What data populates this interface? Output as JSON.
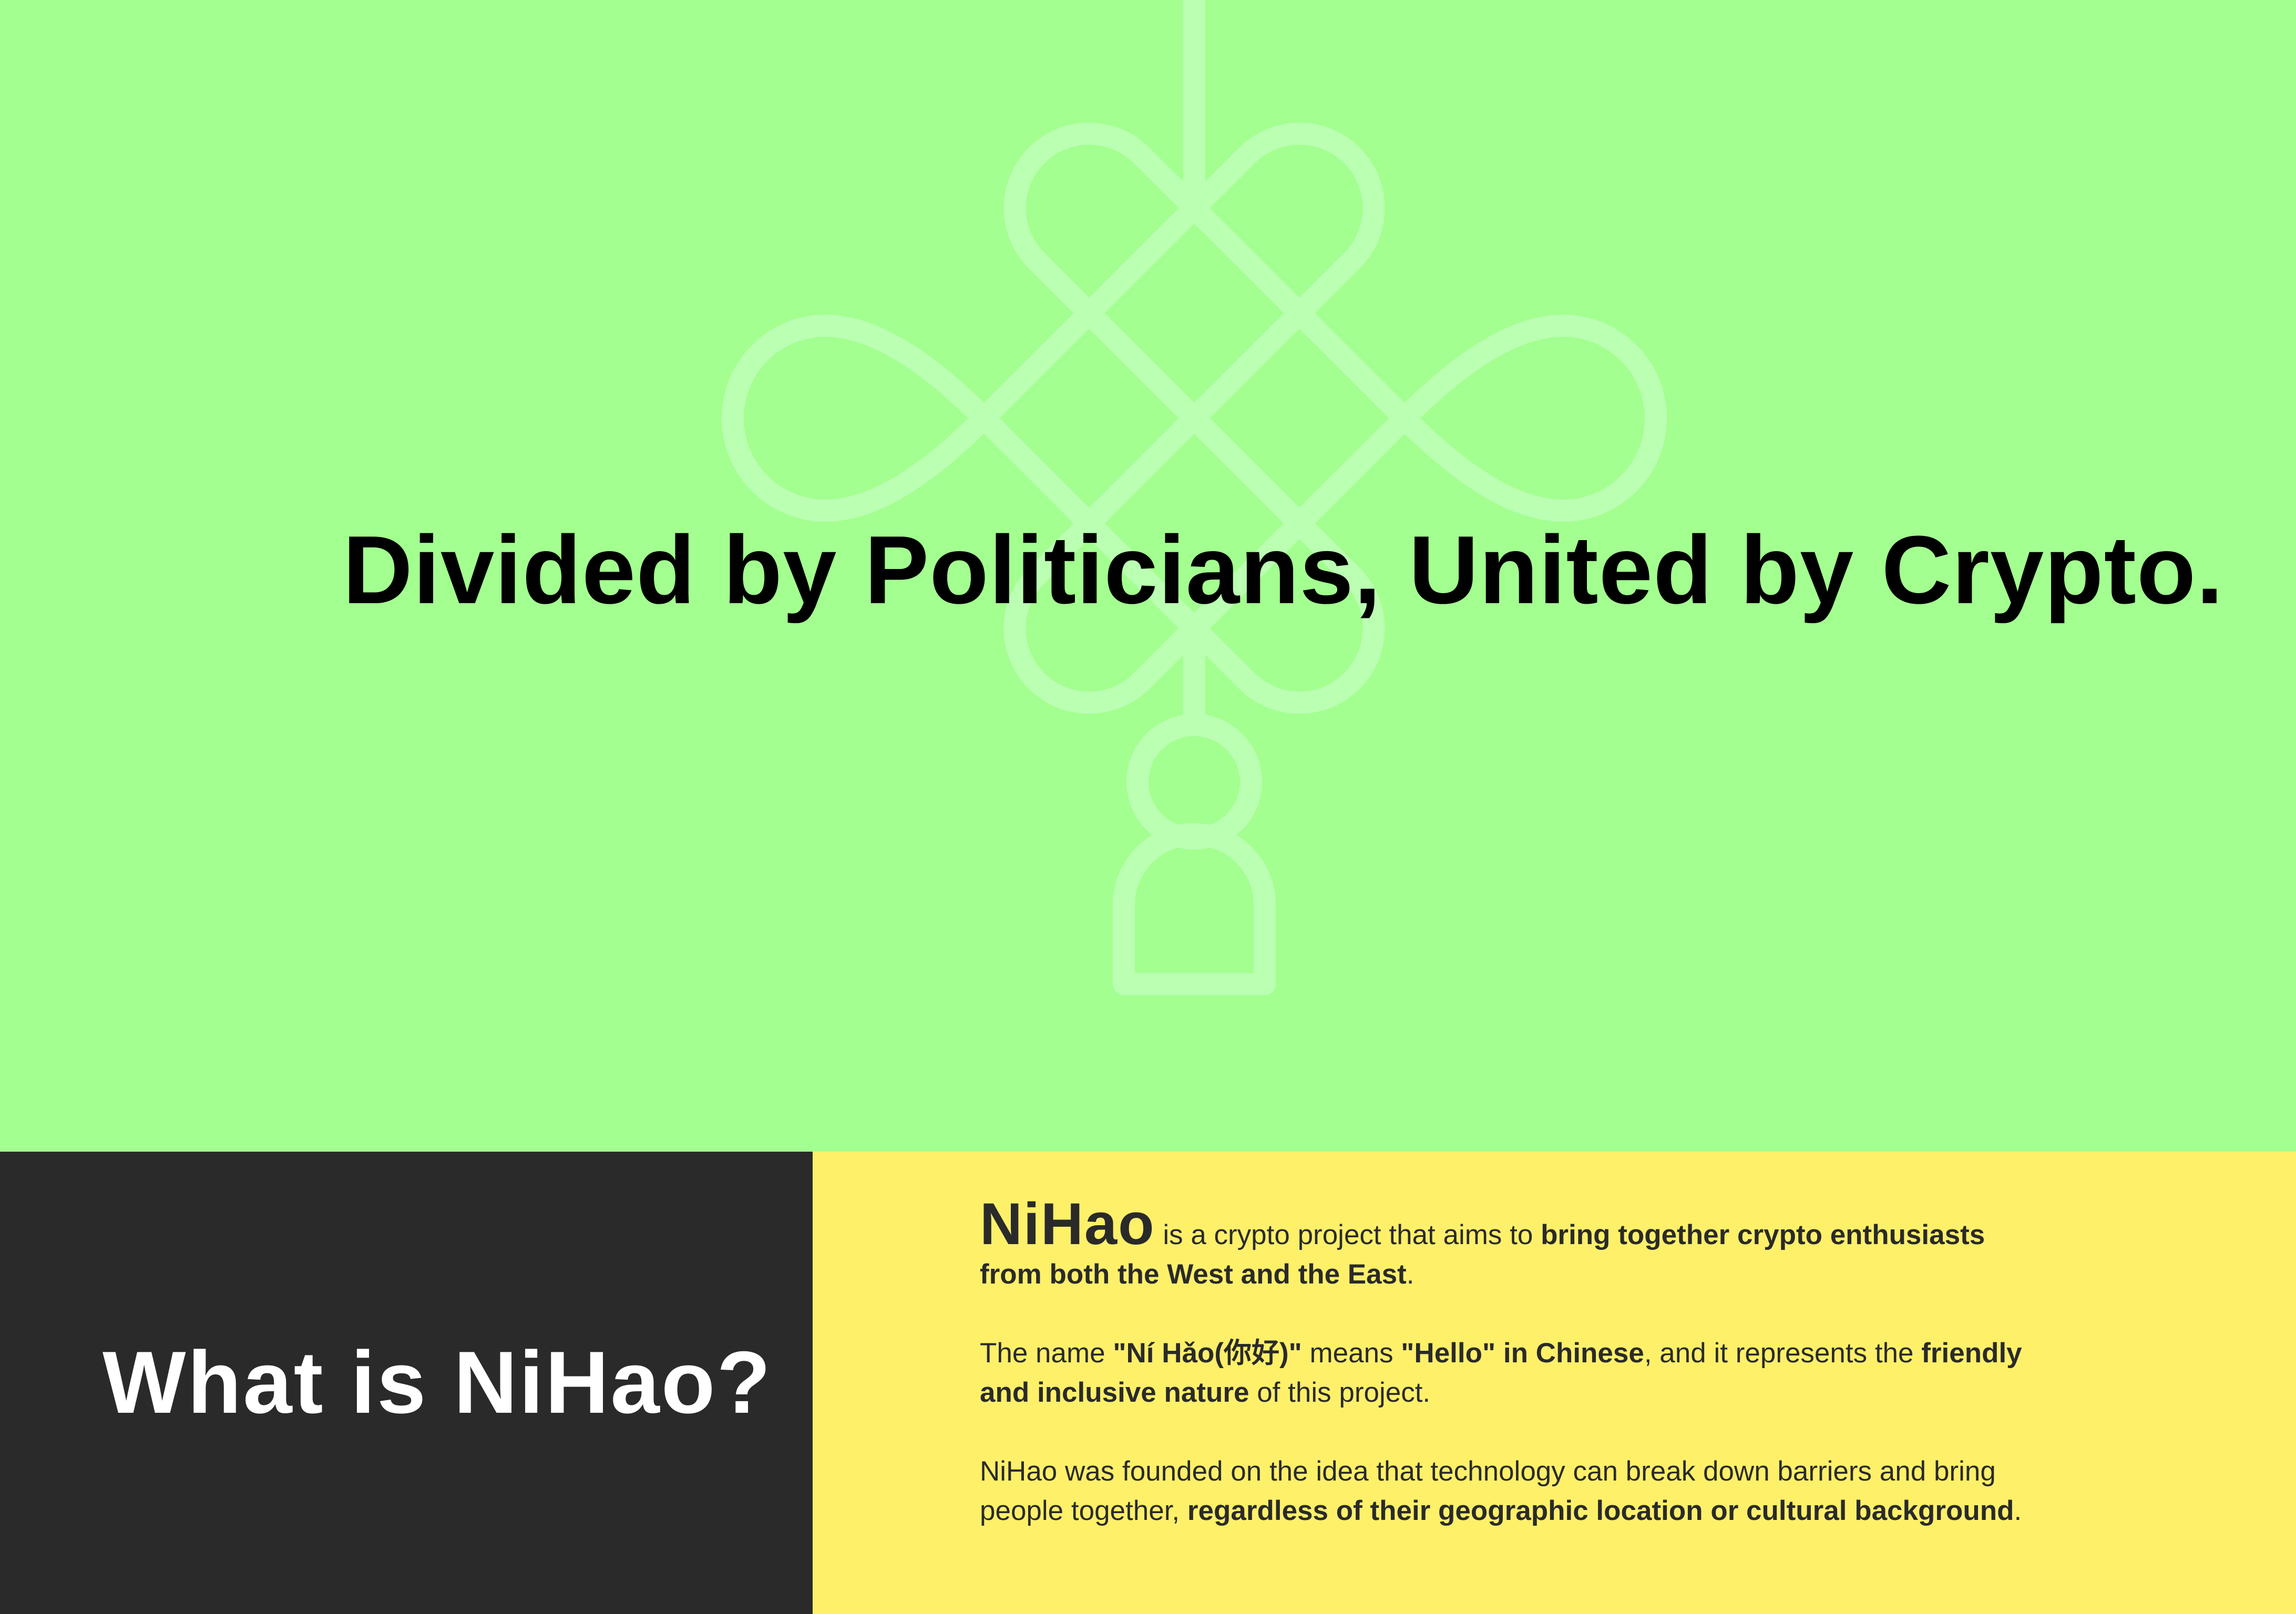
{
  "colors": {
    "hero_bg": "#a3ff8f",
    "knot": "#bbffb3",
    "dark_panel": "#2a2a2a",
    "yellow_panel": "#fff06a",
    "text_dark": "#2a2a2a"
  },
  "hero": {
    "headline": "Divided by Politicians, United by Crypto.",
    "decoration": "chinese-knot-icon"
  },
  "section": {
    "title": "What is NiHao?",
    "p1": {
      "brand": "NiHao",
      "t1": " is a crypto project that aims to ",
      "b1": "bring together crypto enthusiasts",
      "b2": "from both the West and the East",
      "t2": "."
    },
    "p2": {
      "t1": "The name ",
      "b1": "\"Ní Hǎo(你好)\"",
      "t2": " means ",
      "b2": "\"Hello\" in Chinese",
      "t3": ", and it represents the ",
      "b3": "friendly",
      "b4": "and inclusive nature",
      "t4": " of this project."
    },
    "p3": {
      "t1": "NiHao was founded on the idea that technology can break down barriers and bring",
      "t2": "people together, ",
      "b1": "regardless of their geographic location or cultural background",
      "t3": "."
    }
  }
}
